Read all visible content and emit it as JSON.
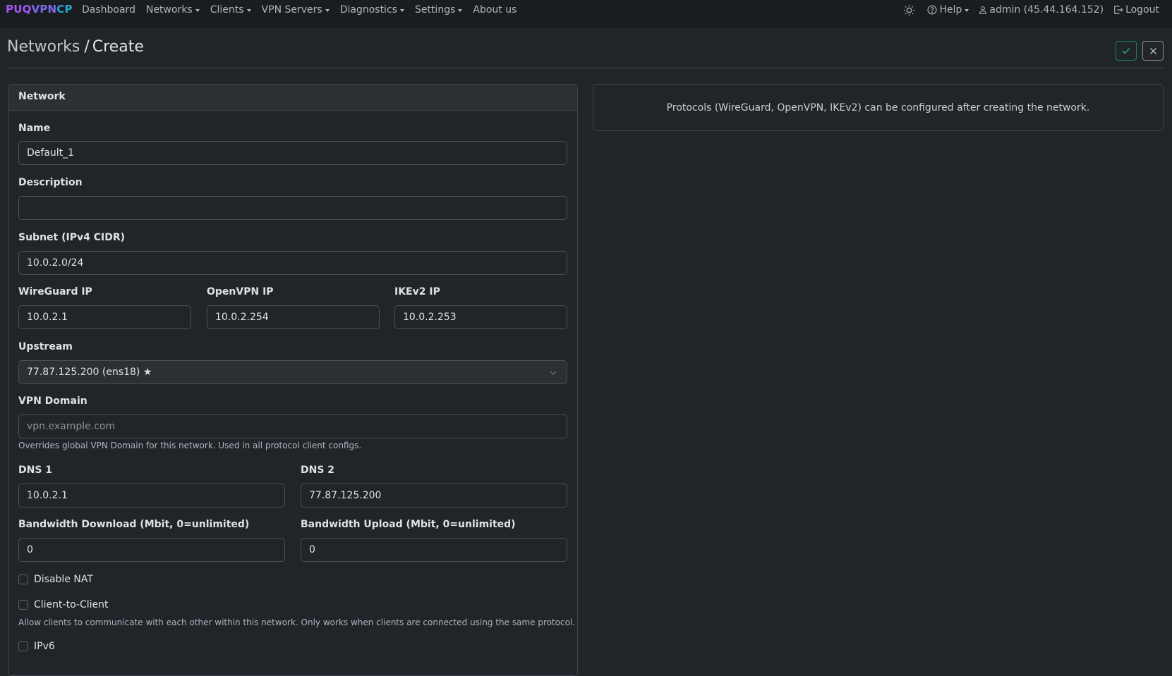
{
  "brand": {
    "part1": "PUQ",
    "part2": "VPN",
    "part3": "CP"
  },
  "nav": {
    "items": [
      {
        "label": "Dashboard",
        "dropdown": false
      },
      {
        "label": "Networks",
        "dropdown": true
      },
      {
        "label": "Clients",
        "dropdown": true
      },
      {
        "label": "VPN Servers",
        "dropdown": true
      },
      {
        "label": "Diagnostics",
        "dropdown": true
      },
      {
        "label": "Settings",
        "dropdown": true
      },
      {
        "label": "About us",
        "dropdown": false
      }
    ],
    "theme_icon": "sun-icon",
    "help_label": "Help",
    "user_label": "admin (45.44.164.152)",
    "logout_label": "Logout"
  },
  "page": {
    "crumb": "Networks",
    "separator": "/",
    "title": "Create",
    "save_icon": "check-icon",
    "close_icon": "x-icon"
  },
  "card": {
    "header": "Network",
    "name_label": "Name",
    "name_value": "Default_1",
    "description_label": "Description",
    "description_value": "",
    "subnet_label": "Subnet (IPv4 CIDR)",
    "subnet_value": "10.0.2.0/24",
    "wireguard_label": "WireGuard IP",
    "wireguard_value": "10.0.2.1",
    "openvpn_label": "OpenVPN IP",
    "openvpn_value": "10.0.2.254",
    "ikev2_label": "IKEv2 IP",
    "ikev2_value": "10.0.2.253",
    "upstream_label": "Upstream",
    "upstream_value": "77.87.125.200 (ens18) ★",
    "vpn_domain_label": "VPN Domain",
    "vpn_domain_placeholder": "vpn.example.com",
    "vpn_domain_help": "Overrides global VPN Domain for this network. Used in all protocol client configs.",
    "dns1_label": "DNS 1",
    "dns1_value": "10.0.2.1",
    "dns2_label": "DNS 2",
    "dns2_value": "77.87.125.200",
    "bw_down_label": "Bandwidth Download (Mbit, 0=unlimited)",
    "bw_down_value": "0",
    "bw_up_label": "Bandwidth Upload (Mbit, 0=unlimited)",
    "bw_up_value": "0",
    "disable_nat_label": "Disable NAT",
    "c2c_label": "Client-to-Client",
    "c2c_help": "Allow clients to communicate with each other within this network. Only works when clients are connected using the same protocol.",
    "ipv6_label": "IPv6"
  },
  "info": {
    "text": "Protocols (WireGuard, OpenVPN, IKEv2) can be configured after creating the network."
  },
  "colors": {
    "background": "#212529",
    "navbar": "#1a1d20",
    "accent_success": "#198754",
    "brand_purple": "#a855f7",
    "brand_blue": "#22a7d6"
  }
}
